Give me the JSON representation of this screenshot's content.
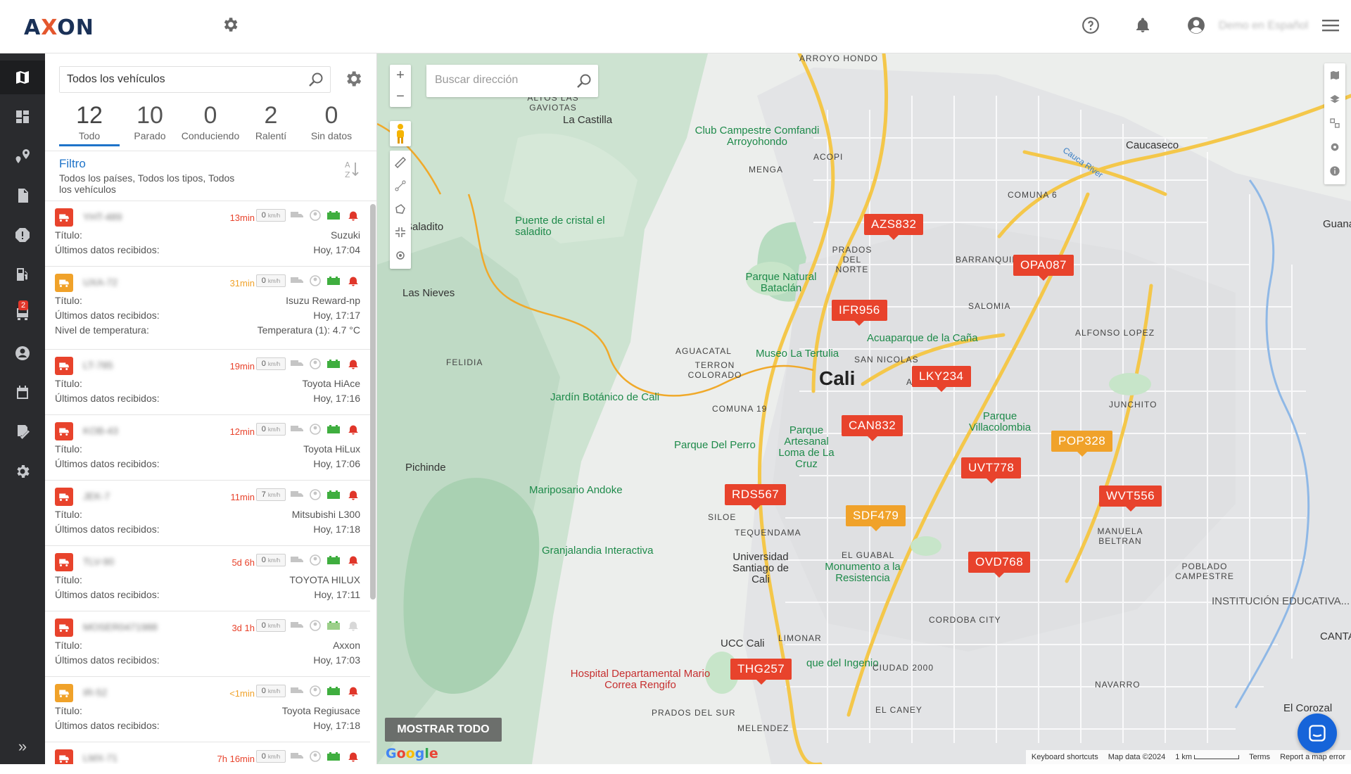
{
  "app": {
    "logo_left": "A",
    "logo_x": "X",
    "logo_right": "ON",
    "user": "Demo en Español"
  },
  "nav": {
    "badge": "2"
  },
  "panel": {
    "search_value": "Todos los vehículos",
    "stats": [
      {
        "num": "12",
        "label": "Todo"
      },
      {
        "num": "10",
        "label": "Parado"
      },
      {
        "num": "0",
        "label": "Conduciendo"
      },
      {
        "num": "2",
        "label": "Ralentí"
      },
      {
        "num": "0",
        "label": "Sin datos"
      }
    ],
    "filter_title": "Filtro",
    "filter_desc": "Todos los países, Todos los tipos, Todos los vehículos",
    "vehicles": [
      {
        "plate": "YHT-489",
        "dur": "13min",
        "speed": "0",
        "labels": [
          "Título:",
          "Últimos datos recibidos:"
        ],
        "values": [
          "Suzuki",
          "Hoy, 17:04"
        ]
      },
      {
        "plate": "UXA-72",
        "dur": "31min",
        "speed": "0",
        "labels": [
          "Título:",
          "Últimos datos recibidos:",
          "Nivel de temperatura:"
        ],
        "values": [
          "Isuzu Reward-np",
          "Hoy, 17:17",
          "Temperatura (1): 4.7 °C"
        ]
      },
      {
        "plate": "LT-785",
        "dur": "19min",
        "speed": "0",
        "labels": [
          "Título:",
          "Últimos datos recibidos:"
        ],
        "values": [
          "Toyota HiAce",
          "Hoy, 17:16"
        ]
      },
      {
        "plate": "KOB-43",
        "dur": "12min",
        "speed": "0",
        "labels": [
          "Título:",
          "Últimos datos recibidos:"
        ],
        "values": [
          "Toyota HiLux",
          "Hoy, 17:06"
        ]
      },
      {
        "plate": "JEK-7",
        "dur": "11min",
        "speed": "7",
        "labels": [
          "Título:",
          "Últimos datos recibidos:"
        ],
        "values": [
          "Mitsubishi L300",
          "Hoy, 17:18"
        ]
      },
      {
        "plate": "TLV-90",
        "dur": "5d 6h",
        "speed": "0",
        "labels": [
          "Título:",
          "Últimos datos recibidos:"
        ],
        "values": [
          "TOYOTA HILUX",
          "Hoy, 17:11"
        ]
      },
      {
        "plate": "MOSER0471988",
        "dur": "3d 1h",
        "speed": "0",
        "labels": [
          "Título:",
          "Últimos datos recibidos:"
        ],
        "values": [
          "Axxon",
          "Hoy, 17:03"
        ]
      },
      {
        "plate": "IR-52",
        "dur": "<1min",
        "speed": "0",
        "labels": [
          "Título:",
          "Últimos datos recibidos:"
        ],
        "values": [
          "Toyota Regiusace",
          "Hoy, 17:18"
        ]
      },
      {
        "plate": "LMX-71",
        "dur": "7h 16min",
        "speed": "0",
        "labels": [],
        "values": []
      }
    ],
    "speed_unit": "km/h"
  },
  "map": {
    "address_placeholder": "Buscar dirección",
    "show_all": "MOSTRAR TODO",
    "google": "Google",
    "attribution": [
      "Keyboard shortcuts",
      "Map data ©2024",
      "1 km",
      "Terms",
      "Report a map error"
    ],
    "city": "Cali",
    "places": [
      "ARROYO HONDO",
      "ALTOS LAS GAVIOTAS",
      "La Castilla",
      "Club Campestre Comfandi Arroyohondo",
      "Caucaseco",
      "MENGA",
      "ACOPI",
      "COMUNA 6",
      "Saladito",
      "Puente de cristal el saladito",
      "PRADOS DEL NORTE",
      "BARRANQUILLA",
      "Parque Natural Bataclán",
      "Las Nieves",
      "SALOMIA",
      "ALFONSO LOPEZ",
      "Acuaparque de la Caña",
      "FELIDIA",
      "AGUACATAL",
      "Museo La Tertulia",
      "SAN NICOLAS",
      "TERRON COLORADO",
      "Jardín Botánico de Cali",
      "AGUA",
      "COMUNA 19",
      "Parque Villacolombia",
      "JUNCHITO",
      "Parque Artesanal Loma de La Cruz",
      "Parque Del Perro",
      "Pichinde",
      "Mariposario Andoke",
      "SILOE",
      "TEQUENDAMA",
      "Granjalandia Interactiva",
      "MANUELA BELTRAN",
      "Universidad Santiago de Cali",
      "EL GUABAL",
      "Monumento a la Resistencia",
      "POBLADO CAMPESTRE",
      "INSTITUCIÓN EDUCATIVA...",
      "CORDOBA CITY",
      "UCC Cali",
      "LIMONAR",
      "que del Ingenio",
      "CIUDAD 2000",
      "Hospital Departamental Mario Correa Rengifo",
      "NAVARRO",
      "PRADOS DEL SUR",
      "EL CANEY",
      "MELENDEZ",
      "El Corozal",
      "CANTA",
      "Guana",
      "Cauca River"
    ],
    "vehicles": [
      {
        "id": "AZS832",
        "color": "#e8432c"
      },
      {
        "id": "OPA087",
        "color": "#e8432c"
      },
      {
        "id": "IFR956",
        "color": "#e8432c"
      },
      {
        "id": "LKY234",
        "color": "#e8432c"
      },
      {
        "id": "CAN832",
        "color": "#e8432c"
      },
      {
        "id": "POP328",
        "color": "#f0a22a"
      },
      {
        "id": "UVT778",
        "color": "#e8432c"
      },
      {
        "id": "RDS567",
        "color": "#e8432c"
      },
      {
        "id": "SDF479",
        "color": "#f0a22a"
      },
      {
        "id": "WVT556",
        "color": "#e8432c"
      },
      {
        "id": "OVD768",
        "color": "#e8432c"
      },
      {
        "id": "THG257",
        "color": "#e8432c"
      }
    ]
  },
  "colors": {
    "accent": "#1e73c9",
    "parked": "#e8432c",
    "idle": "#f0a22a",
    "nav_bg": "#2a2b2e"
  }
}
